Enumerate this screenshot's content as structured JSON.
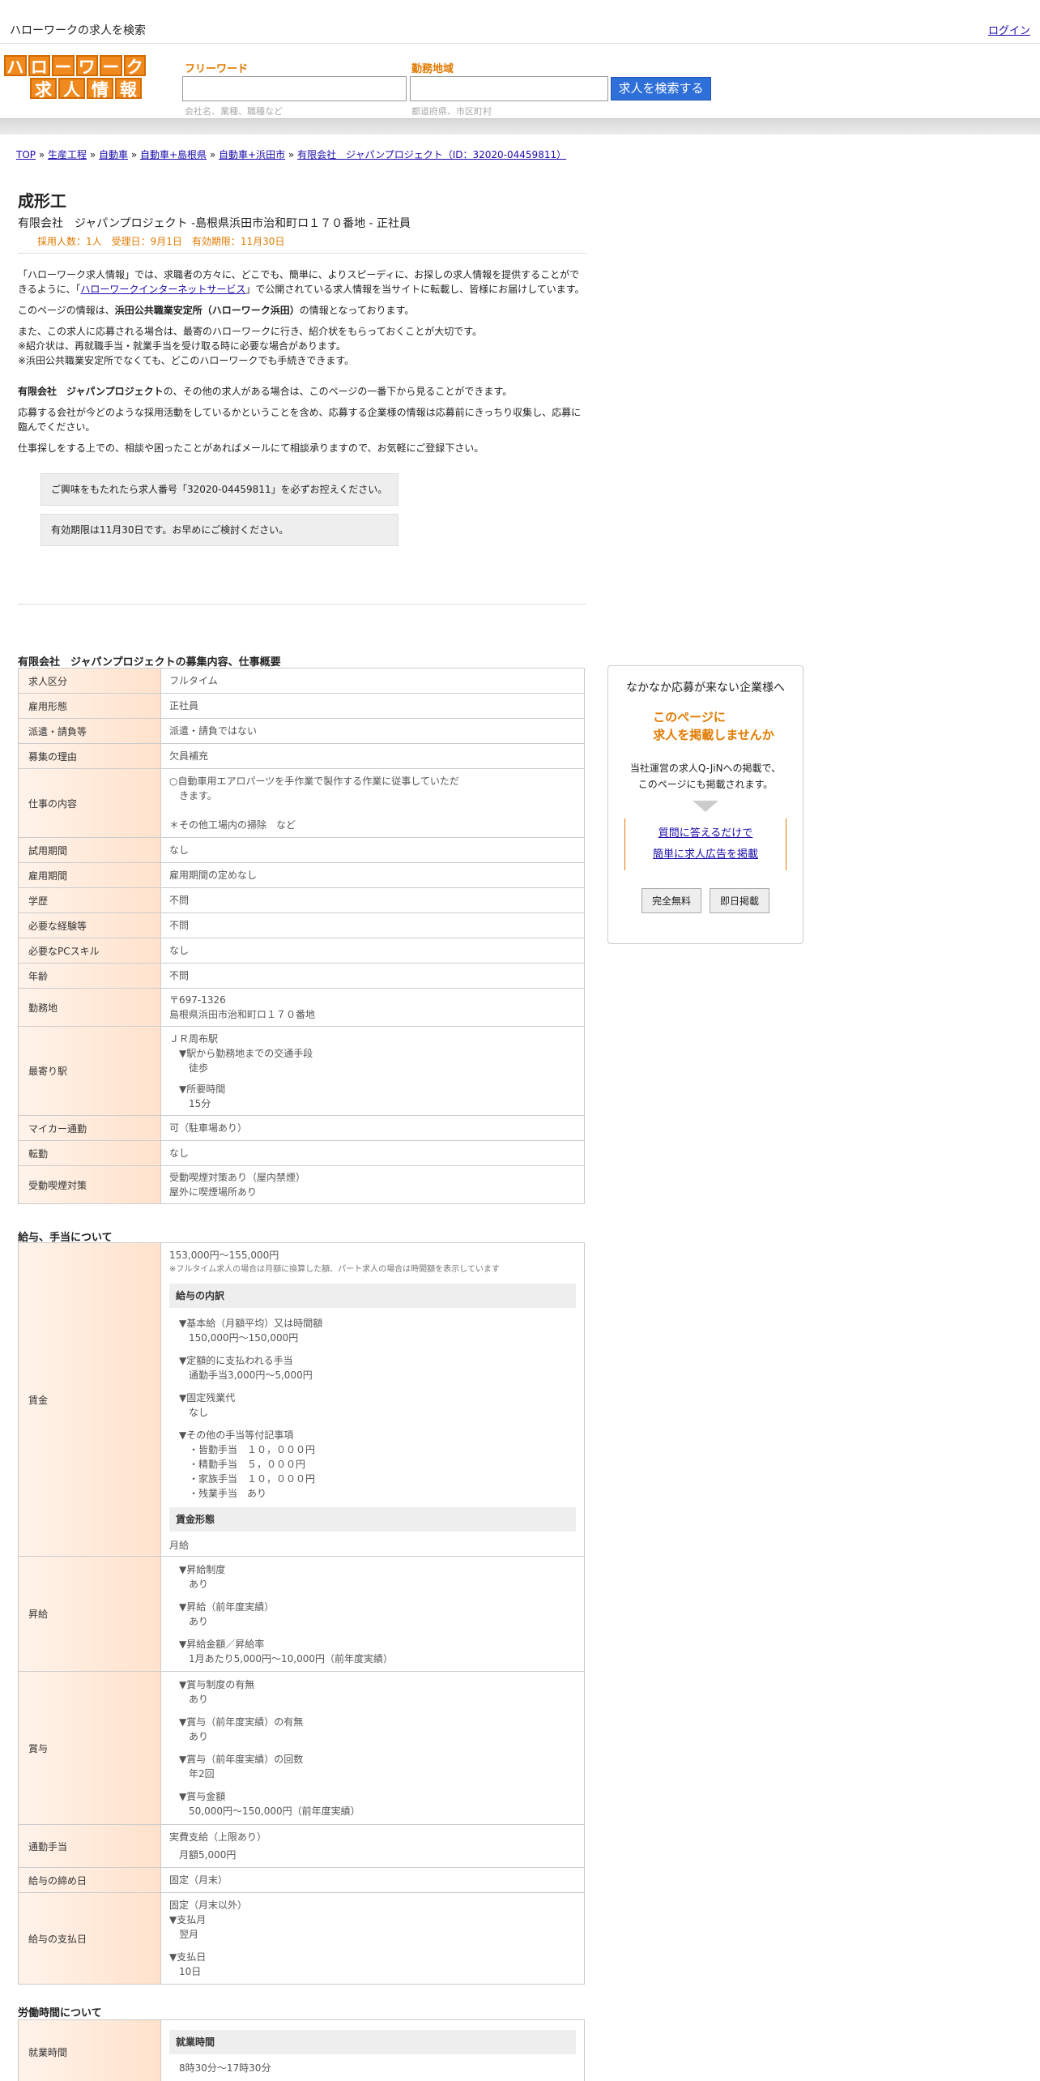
{
  "header": {
    "site_title": "ハローワークの求人を検索",
    "login": "ログイン"
  },
  "logo": {
    "row1": [
      "ハ",
      "ロ",
      "ー",
      "ワ",
      "ー",
      "ク"
    ],
    "row2": [
      "求",
      "人",
      "情",
      "報"
    ]
  },
  "search": {
    "free_label": "フリーワード",
    "area_label": "勤務地域",
    "button": "求人を検索する",
    "free_hint": "会社名、業種、職種など",
    "area_hint": "都道府県、市区町村"
  },
  "breadcrumb": [
    "TOP",
    "生産工程",
    "自動車",
    "自動車+島根県",
    "自動車+浜田市",
    "有限会社　ジャパンプロジェクト（ID：32020-04459811）"
  ],
  "job": {
    "title": "成形工",
    "subtitle": "有限会社　ジャパンプロジェクト -島根県浜田市治和町ロ１７０番地 - 正社員",
    "meta": "採用人数：1人　受理日：9月1日　有効期限：11月30日"
  },
  "intro": {
    "p1a": "「ハローワーク求人情報」では、求職者の方々に、どこでも、簡単に、よりスピーディに、お探しの求人情報を提供することができるように、「",
    "p1link": "ハローワークインターネットサービス",
    "p1b": "」で公開されている求人情報を当サイトに転載し、皆様にお届けしています。",
    "p2a": "このページの情報は、",
    "p2b": "浜田公共職業安定所（ハローワーク浜田）",
    "p2c": "の情報となっております。",
    "p3_1": "また、この求人に応募される場合は、最寄のハローワークに行き、紹介状をもらっておくことが大切です。",
    "p3_2": "※紹介状は、再就職手当・就業手当を受け取る時に必要な場合があります。",
    "p3_3": "※浜田公共職業安定所でなくても、どこのハローワークでも手続きできます。",
    "p4a": "有限会社　ジャパンプロジェクト",
    "p4b": "の、その他の求人がある場合は、このページの一番下から見ることができます。",
    "p5": "応募する会社が今どのような採用活動をしているかということを含め、応募する企業様の情報は応募前にきっちり収集し、応募に臨んでください。",
    "p6": "仕事探しをする上での、相談や困ったことがあればメールにて相談承りますので、お気軽にご登録下さい。",
    "notice1": "ご興味をもたれたら求人番号「32020-04459811」を必ずお控えください。",
    "notice2": "有効期限は11月30日です。お早めにご検討ください。"
  },
  "section1": {
    "title": "有限会社　ジャパンプロジェクトの募集内容、仕事概要",
    "rows": {
      "r1": [
        "求人区分",
        "フルタイム"
      ],
      "r2": [
        "雇用形態",
        "正社員"
      ],
      "r3": [
        "派遣・請負等",
        "派遣・請負ではない"
      ],
      "r4": [
        "募集の理由",
        "欠員補充"
      ],
      "r5": [
        "仕事の内容",
        "○自動車用エアロパーツを手作業で製作する作業に従事していただ",
        "　きます。",
        "＊その他工場内の掃除　など"
      ],
      "r6": [
        "試用期間",
        "なし"
      ],
      "r7": [
        "雇用期間",
        "雇用期間の定めなし"
      ],
      "r8": [
        "学歴",
        "不問"
      ],
      "r9": [
        "必要な経験等",
        "不問"
      ],
      "r10": [
        "必要なPCスキル",
        "なし"
      ],
      "r11": [
        "年齢",
        "不問"
      ],
      "r12": [
        "勤務地",
        "〒697-1326",
        "島根県浜田市治和町ロ１７０番地"
      ],
      "r13": [
        "最寄り駅",
        "ＪＲ周布駅",
        "▼駅から勤務地までの交通手段",
        "徒歩",
        "▼所要時間",
        "15分"
      ],
      "r14": [
        "マイカー通勤",
        "可（駐車場あり）"
      ],
      "r15": [
        "転勤",
        "なし"
      ],
      "r16": [
        "受動喫煙対策",
        "受動喫煙対策あり（屋内禁煙）",
        "屋外に喫煙場所あり"
      ]
    }
  },
  "section2": {
    "title": "給与、手当について",
    "wage": {
      "label": "賃金",
      "amount": "153,000円〜155,000円",
      "note": "※フルタイム求人の場合は月額に換算した額、パート求人の場合は時間額を表示しています",
      "breakdown_title": "給与の内訳",
      "b1": "▼基本給（月額平均）又は時間額",
      "b1v": "150,000円〜150,000円",
      "b2": "▼定額的に支払われる手当",
      "b2v": "通勤手当3,000円〜5,000円",
      "b3": "▼固定残業代",
      "b3v": "なし",
      "b4": "▼その他の手当等付記事項",
      "b4v1": "・皆勤手当　１０，０００円",
      "b4v2": "・精勤手当　５，０００円",
      "b4v3": "・家族手当　１０，０００円",
      "b4v4": "・残業手当　あり",
      "form_title": "賃金形態",
      "form": "月給"
    },
    "raise": {
      "label": "昇給",
      "a": "▼昇給制度",
      "av": "あり",
      "b": "▼昇給（前年度実績）",
      "bv": "あり",
      "c": "▼昇給金額／昇給率",
      "cv": "1月あたり5,000円〜10,000円（前年度実績）"
    },
    "bonus": {
      "label": "賞与",
      "a": "▼賞与制度の有無",
      "av": "あり",
      "b": "▼賞与（前年度実績）の有無",
      "bv": "あり",
      "c": "▼賞与（前年度実績）の回数",
      "cv": "年2回",
      "d": "▼賞与金額",
      "dv": "50,000円〜150,000円（前年度実績）"
    },
    "commute": {
      "label": "通勤手当",
      "a": "実費支給（上限あり）",
      "b": "月額5,000円"
    },
    "cutoff": {
      "label": "給与の締め日",
      "v": "固定（月末）"
    },
    "payday": {
      "label": "給与の支払日",
      "a": "固定（月末以外）",
      "b": "▼支払月",
      "bv": "翌月",
      "c": "▼支払日",
      "cv": "10日"
    }
  },
  "section3": {
    "title": "労働時間について",
    "hours": {
      "label": "就業時間",
      "sub": "就業時間",
      "v": "8時30分〜17時30分"
    }
  },
  "side_ad": {
    "t1": "なかなか応募が来ない企業様へ",
    "t2a": "このページに",
    "t2b": "求人を掲載しませんか",
    "t3a": "当社運営の求人Q-JiNへの掲載で、",
    "t3b": "このページにも掲載されます。",
    "link1": "質問に答えるだけで",
    "link2": "簡単に求人広告を掲載",
    "btn1": "完全無料",
    "btn2": "即日掲載"
  },
  "colors": {
    "accent_orange": "#e07a00",
    "button_blue": "#2f6fd9",
    "logo_orange": "#f08a1e"
  }
}
